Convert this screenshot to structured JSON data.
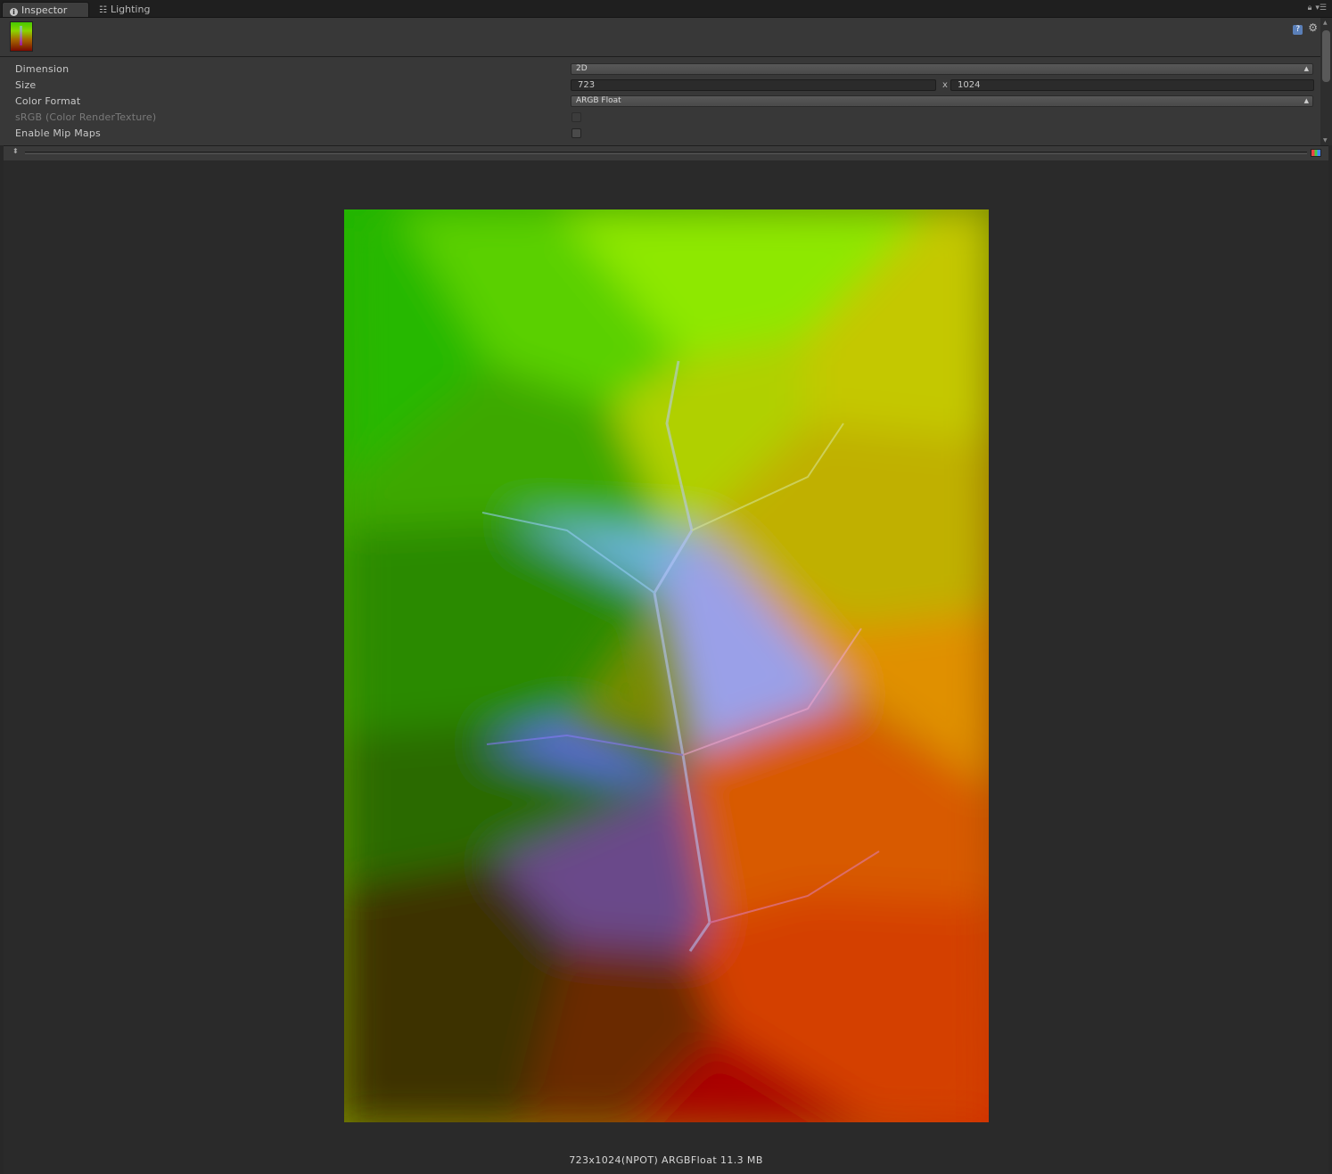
{
  "tabs": [
    {
      "label": "Inspector",
      "active": true
    },
    {
      "label": "Lighting",
      "active": false
    }
  ],
  "properties": {
    "dimension": {
      "label": "Dimension",
      "value": "2D"
    },
    "size": {
      "label": "Size",
      "width": "723",
      "separator": "x",
      "height": "1024"
    },
    "color_format": {
      "label": "Color Format",
      "value": "ARGB Float"
    },
    "srgb": {
      "label": "sRGB (Color RenderTexture)",
      "checked": false,
      "disabled": true
    },
    "mipmaps": {
      "label": "Enable Mip Maps",
      "checked": false
    }
  },
  "preview": {
    "info": "723x1024(NPOT)  ARGBFloat  11.3 MB"
  },
  "colors": {
    "panel_bg": "#383838",
    "preview_bg": "#2a2a2a",
    "tab_bar": "#1f1f1f"
  }
}
